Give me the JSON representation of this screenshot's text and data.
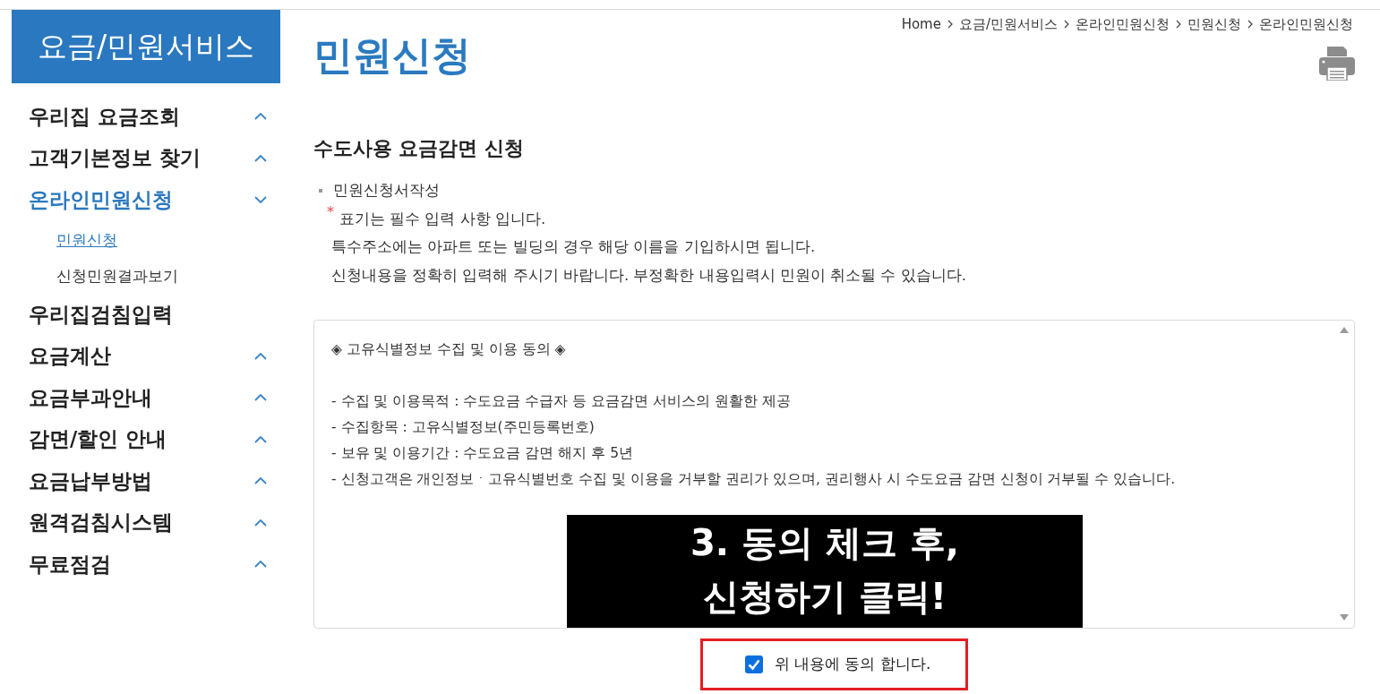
{
  "sidebar": {
    "title": "요금/민원서비스",
    "items": [
      {
        "label": "우리집 요금조회",
        "kind": "group",
        "expanded": false,
        "selected": false
      },
      {
        "label": "고객기본정보 찾기",
        "kind": "group",
        "expanded": false,
        "selected": false
      },
      {
        "label": "온라인민원신청",
        "kind": "group",
        "expanded": true,
        "selected": true,
        "children": [
          {
            "label": "민원신청",
            "selected": true
          },
          {
            "label": "신청민원결과보기",
            "selected": false
          }
        ]
      },
      {
        "label": "우리집검침입력",
        "kind": "link",
        "selected": false
      },
      {
        "label": "요금계산",
        "kind": "group",
        "expanded": false,
        "selected": false
      },
      {
        "label": "요금부과안내",
        "kind": "group",
        "expanded": false,
        "selected": false
      },
      {
        "label": "감면/할인 안내",
        "kind": "group",
        "expanded": false,
        "selected": false
      },
      {
        "label": "요금납부방법",
        "kind": "group",
        "expanded": false,
        "selected": false
      },
      {
        "label": "원격검침시스템",
        "kind": "group",
        "expanded": false,
        "selected": false
      },
      {
        "label": "무료점검",
        "kind": "group",
        "expanded": false,
        "selected": false
      }
    ]
  },
  "breadcrumb": [
    "Home",
    "요금/민원서비스",
    "온라인민원신청",
    "민원신청",
    "온라인민원신청"
  ],
  "page_title": "민원신청",
  "section_title": "수도사용 요금감면 신청",
  "form_guide": {
    "title": "민원신청서작성",
    "notes": [
      {
        "text": "표기는 필수 입력 사항 입니다.",
        "mark": "*"
      },
      {
        "text": "특수주소에는 아파트 또는 빌딩의 경우 해당 이름을 기입하시면 됩니다."
      },
      {
        "text": "신청내용을 정확히 입력해 주시기 바랍니다. 부정확한 내용입력시 민원이 취소될 수 있습니다."
      }
    ]
  },
  "consent_box": {
    "heading": "◈ 고유식별정보 수집 및 이용 동의 ◈",
    "lines": [
      "- 수집 및 이용목적 : 수도요금 수급자 등 요금감면 서비스의 원활한 제공",
      "- 수집항목 : 고유식별정보(주민등록번호)",
      "- 보유 및 이용기간 : 수도요금 감면 해지 후 5년",
      "- 신청고객은 개인정보ㆍ고유식별번호 수집 및 이용을 거부할 권리가 있으며, 권리행사 시 수도요금 감면 신청이 거부될 수 있습니다."
    ]
  },
  "caption_banner": {
    "lines": [
      "3. 동의 체크 후,",
      "신청하기 클릭!"
    ]
  },
  "agreement": {
    "label": "위 내용에 동의 합니다.",
    "checked": true,
    "highlighted": true
  }
}
